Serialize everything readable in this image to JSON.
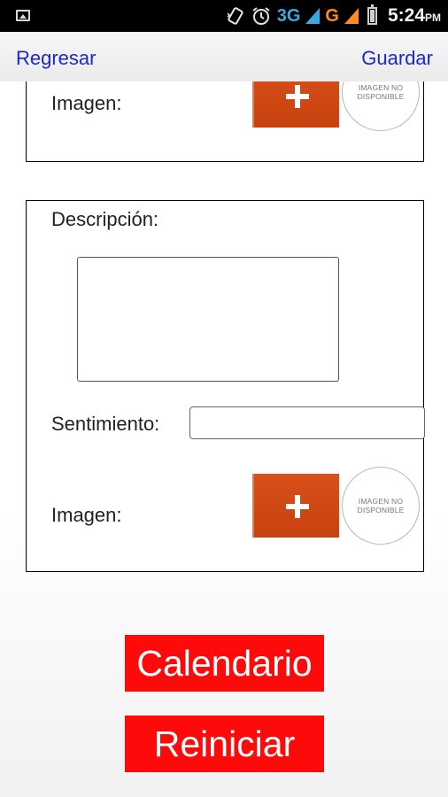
{
  "status_bar": {
    "network_3g": "3G",
    "network_g": "G",
    "time": "5:24",
    "ampm": "PM",
    "icons": [
      "image-notification-icon",
      "vibrate-icon",
      "alarm-icon",
      "signal-icon",
      "battery-icon"
    ]
  },
  "nav": {
    "back_label": "Regresar",
    "save_label": "Guardar",
    "link_color": "#1a27d8"
  },
  "top_panel": {
    "image_label": "Imagen:",
    "no_image_text": "IMAGEN NO DISPONIBLE"
  },
  "main_panel": {
    "description_label": "Descripción:",
    "description_value": "",
    "feeling_label": "Sentimiento:",
    "feeling_value": "",
    "image_label": "Imagen:",
    "no_image_text": "IMAGEN NO DISPONIBLE"
  },
  "buttons": {
    "calendar_label": "Calendario",
    "reset_label": "Reiniciar",
    "button_color": "#ff0a0a",
    "add_button_color": "#d0480f"
  }
}
